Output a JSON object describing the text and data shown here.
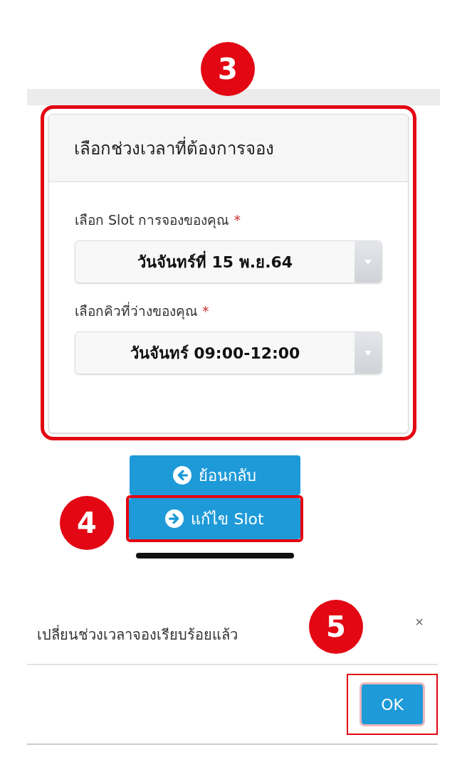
{
  "booking_form": {
    "badge": "3",
    "title": "เลือกช่วงเวลาที่ต้องการจอง",
    "highlighted": true,
    "fields": [
      {
        "label": "เลือก Slot การจองของคุณ",
        "required_mark": "*",
        "value": "วันจันทร์ที่ 15 พ.ย.64"
      },
      {
        "label": "เลือกคิวที่ว่างของคุณ",
        "required_mark": "*",
        "value": "วันจันทร์ 09:00-12:00"
      }
    ]
  },
  "buttons": [
    {
      "kind": "back",
      "label": "ย้อนกลับ",
      "highlighted": false
    },
    {
      "kind": "forward",
      "label": "แก้ไข Slot",
      "highlighted": true,
      "badge": "4"
    }
  ],
  "dialog": {
    "message": "เปลี่ยนช่วงเวลาจองเรียบร้อยแล้ว",
    "close": "×",
    "badge": "5",
    "ok_button": {
      "label": "OK",
      "highlighted": true
    }
  }
}
